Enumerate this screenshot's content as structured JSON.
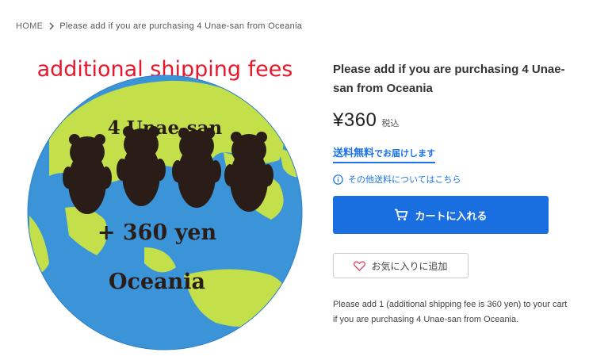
{
  "breadcrumb": {
    "home": "HOME",
    "current": "Please add if you are purchasing 4 Unae-san from Oceania"
  },
  "product_image": {
    "heading": "additional shipping fees",
    "line1": "4 Unae-san",
    "line2": "+ 360 yen",
    "line3": "Oceania",
    "colors": {
      "heading": "#e8182c",
      "ocean": "#3c94d8",
      "land": "#c3e04a",
      "bear": "#2a1d18"
    }
  },
  "product": {
    "title": "Please add if you are purchasing 4 Unae-san from Oceania",
    "price": "¥360",
    "tax_label": "税込",
    "free_shipping_strong": "送料無料",
    "free_shipping_rest": "でお届けします",
    "other_shipping_link": "その他送料についてはこちら",
    "add_to_cart": "カートに入れる",
    "add_to_favorites": "お気に入りに追加",
    "description": "Please add 1 (additional shipping fee is 360 yen) to your cart if you are purchasing 4 Unae-san from Oceania."
  },
  "colors": {
    "accent": "#1a6fe0",
    "link": "#1a73e8"
  }
}
